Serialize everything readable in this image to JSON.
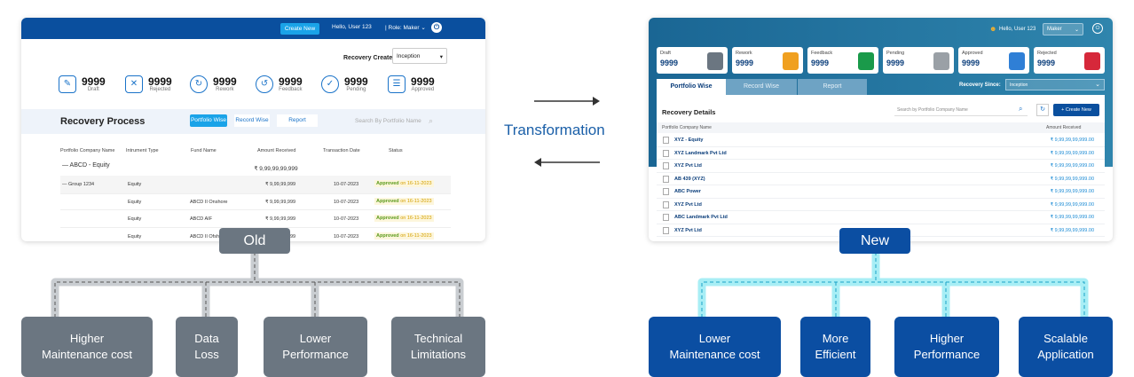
{
  "middle": {
    "title": "Transformation"
  },
  "old": {
    "tag": "Old",
    "header": {
      "create_button": "Create New",
      "hello": "Hello, User 123",
      "role": "| Role:  Maker  ⌄"
    },
    "recovery_created_label": "Recovery Created:",
    "recovery_created_value": "Inception",
    "stats": [
      {
        "value": "9999",
        "label": "Draft"
      },
      {
        "value": "9999",
        "label": "Rejected"
      },
      {
        "value": "9999",
        "label": "Rework"
      },
      {
        "value": "9999",
        "label": "Feedback"
      },
      {
        "value": "9999",
        "label": "Pending"
      },
      {
        "value": "9999",
        "label": "Approved"
      }
    ],
    "section_title": "Recovery Process",
    "tabs": [
      "Portfolio Wise",
      "Record Wise",
      "Report"
    ],
    "search_placeholder": "Search By Portfolio Name",
    "columns": [
      "Portfolio Company Name",
      "Intrument Type",
      "Fund Name",
      "Amount Received",
      "Transaction Date",
      "Status"
    ],
    "group_name": "—  ABCD - Equity",
    "group_amount": "₹ 9,99,99,99,999",
    "rows": [
      {
        "company": "—  Group 1234",
        "type": "Equity",
        "fund": "",
        "amount": "₹ 9,99,99,999",
        "date": "10-07-2023",
        "status": "Approved",
        "status_date": "on 16-11-2023"
      },
      {
        "company": "",
        "type": "Equity",
        "fund": "ABCD II Onshore",
        "amount": "₹ 9,99,99,999",
        "date": "10-07-2023",
        "status": "Approved",
        "status_date": "on 16-11-2023"
      },
      {
        "company": "",
        "type": "Equity",
        "fund": "ABCD AIF",
        "amount": "₹ 9,99,99,999",
        "date": "10-07-2023",
        "status": "Approved",
        "status_date": "on 16-11-2023"
      },
      {
        "company": "",
        "type": "Equity",
        "fund": "ABCD II Ofsh",
        "amount": "₹ 9,99,99,999",
        "date": "10-07-2023",
        "status": "Approved",
        "status_date": "on 16-11-2023"
      }
    ],
    "outcomes": [
      {
        "line1": "Higher",
        "line2": "Maintenance cost"
      },
      {
        "line1": "Data",
        "line2": "Loss"
      },
      {
        "line1": "Lower",
        "line2": "Performance"
      },
      {
        "line1": "Technical",
        "line2": "Limitations"
      }
    ]
  },
  "new": {
    "tag": "New",
    "header": {
      "hello": "Hello, User 123",
      "role_select": "Maker"
    },
    "cards": [
      {
        "label": "Draft",
        "value": "9999",
        "color": "#6b7681"
      },
      {
        "label": "Rework",
        "value": "9999",
        "color": "#f0a020"
      },
      {
        "label": "Feedback",
        "value": "9999",
        "color": "#1a9a4a"
      },
      {
        "label": "Pending",
        "value": "9999",
        "color": "#9aa0a6"
      },
      {
        "label": "Approved",
        "value": "9999",
        "color": "#2f7fd6"
      },
      {
        "label": "Rejected",
        "value": "9999",
        "color": "#d6283a"
      }
    ],
    "tabs": [
      "Portfolio Wise",
      "Record Wise",
      "Report"
    ],
    "recovery_since_label": "Recovery Since:",
    "recovery_since_value": "Inception",
    "panel_title": "Recovery Details",
    "search_placeholder": "Search by Portfolio Company Name",
    "create_button": "+  Create New",
    "columns": [
      "Portfolio Company Name",
      "Amount Received"
    ],
    "rows": [
      {
        "name": "XYZ - Equity",
        "amount": "₹ 9,99,99,99,999.00"
      },
      {
        "name": "XYZ Landmark Pvt Ltd",
        "amount": "₹ 9,99,99,99,999.00"
      },
      {
        "name": "XYZ Pvt Ltd",
        "amount": "₹ 9,99,99,99,999.00"
      },
      {
        "name": "AB 439 (XYZ)",
        "amount": "₹ 9,99,99,99,999.00"
      },
      {
        "name": "ABC Power",
        "amount": "₹ 9,99,99,99,999.00"
      },
      {
        "name": "XYZ Pvt Ltd",
        "amount": "₹ 9,99,99,99,999.00"
      },
      {
        "name": "ABC Landmark Pvt Ltd",
        "amount": "₹ 9,99,99,99,999.00"
      },
      {
        "name": "XYZ Pvt Ltd",
        "amount": "₹ 9,99,99,99,999.00"
      }
    ],
    "outcomes": [
      {
        "line1": "Lower",
        "line2": "Maintenance cost"
      },
      {
        "line1": "More",
        "line2": "Efficient"
      },
      {
        "line1": "Higher",
        "line2": "Performance"
      },
      {
        "line1": "Scalable",
        "line2": "Application"
      }
    ]
  }
}
